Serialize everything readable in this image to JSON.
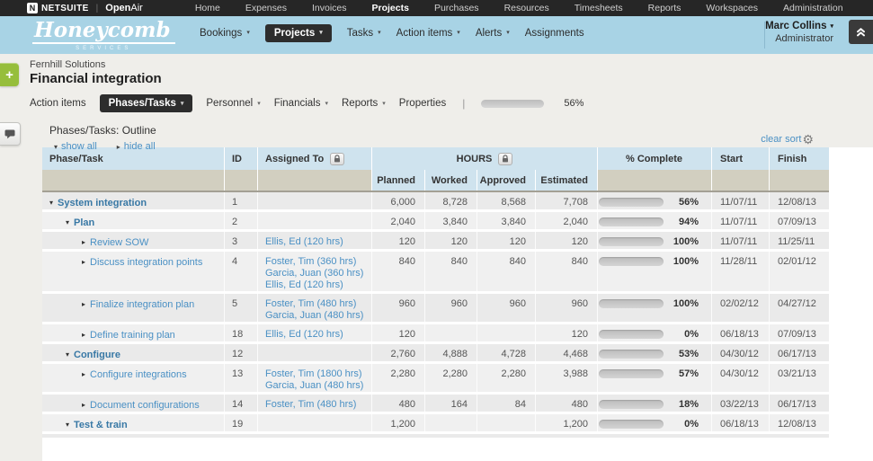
{
  "colors": {
    "accent_blue": "#4fb1e1",
    "header_blue": "#cfe3ee",
    "tan": "#d2cfc0",
    "nav_blue": "#a8d3e5",
    "add_green": "#96be3c"
  },
  "topnav": {
    "netsuite_icon": "N",
    "netsuite": "NETSUITE",
    "openair_bold": "Open",
    "openair_light": "Air",
    "items": [
      {
        "label": "Home"
      },
      {
        "label": "Expenses"
      },
      {
        "label": "Invoices"
      },
      {
        "label": "Projects",
        "active": true
      },
      {
        "label": "Purchases"
      },
      {
        "label": "Resources"
      },
      {
        "label": "Timesheets"
      },
      {
        "label": "Reports"
      },
      {
        "label": "Workspaces"
      },
      {
        "label": "Administration"
      }
    ]
  },
  "subnav": {
    "logo_name": "Honeycomb",
    "logo_sub": "SERVICES",
    "items": [
      {
        "label": "Bookings",
        "dropdown": true
      },
      {
        "label": "Projects",
        "dropdown": true,
        "active": true
      },
      {
        "label": "Tasks",
        "dropdown": true
      },
      {
        "label": "Action items",
        "dropdown": true
      },
      {
        "label": "Alerts",
        "dropdown": true
      },
      {
        "label": "Assignments"
      }
    ],
    "user": {
      "name": "Marc Collins",
      "role": "Administrator"
    }
  },
  "header": {
    "client": "Fernhill Solutions",
    "project": "Financial integration",
    "add_label": "+"
  },
  "tabs": {
    "items": [
      {
        "label": "Action items"
      },
      {
        "label": "Phases/Tasks",
        "dropdown": true,
        "active": true
      },
      {
        "label": "Personnel",
        "dropdown": true
      },
      {
        "label": "Financials",
        "dropdown": true
      },
      {
        "label": "Reports",
        "dropdown": true
      },
      {
        "label": "Properties"
      }
    ],
    "progress_percent": 56,
    "progress_label": "56%"
  },
  "section": {
    "title": "Phases/Tasks: Outline",
    "show_all": "show all",
    "hide_all": "hide all",
    "clear_sort": "clear sort"
  },
  "table": {
    "headers": {
      "phase_task": "Phase/Task",
      "id": "ID",
      "assigned_to": "Assigned To",
      "hours": "HOURS",
      "planned": "Planned",
      "worked": "Worked",
      "approved": "Approved",
      "estimated": "Estimated",
      "pct_complete": "% Complete",
      "start": "Start",
      "finish": "Finish"
    },
    "rows": [
      {
        "level": 1,
        "type": "phase",
        "arrow": "expanded",
        "name": "System integration",
        "id": "1",
        "assigned": [],
        "planned": "6,000",
        "worked": "8,728",
        "approved": "8,568",
        "estimated": "7,708",
        "percent": 56,
        "percent_label": "56%",
        "start": "11/07/11",
        "finish": "12/08/13"
      },
      {
        "level": 2,
        "type": "phase",
        "arrow": "expanded",
        "name": "Plan",
        "id": "2",
        "assigned": [],
        "planned": "2,040",
        "worked": "3,840",
        "approved": "3,840",
        "estimated": "2,040",
        "percent": 94,
        "percent_label": "94%",
        "start": "11/07/11",
        "finish": "07/09/13"
      },
      {
        "level": 3,
        "type": "task",
        "arrow": "collapsed",
        "name": "Review SOW",
        "id": "3",
        "assigned": [
          "Ellis, Ed (120 hrs)"
        ],
        "planned": "120",
        "worked": "120",
        "approved": "120",
        "estimated": "120",
        "percent": 100,
        "percent_label": "100%",
        "start": "11/07/11",
        "finish": "11/25/11"
      },
      {
        "level": 3,
        "type": "task",
        "arrow": "collapsed",
        "name": "Discuss integration points",
        "id": "4",
        "assigned": [
          "Foster, Tim (360 hrs)",
          "Garcia, Juan (360 hrs)",
          "Ellis, Ed (120 hrs)"
        ],
        "planned": "840",
        "worked": "840",
        "approved": "840",
        "estimated": "840",
        "percent": 100,
        "percent_label": "100%",
        "start": "11/28/11",
        "finish": "02/01/12"
      },
      {
        "level": 3,
        "type": "task",
        "arrow": "collapsed",
        "name": "Finalize integration plan",
        "id": "5",
        "assigned": [
          "Foster, Tim (480 hrs)",
          "Garcia, Juan (480 hrs)"
        ],
        "planned": "960",
        "worked": "960",
        "approved": "960",
        "estimated": "960",
        "percent": 100,
        "percent_label": "100%",
        "start": "02/02/12",
        "finish": "04/27/12"
      },
      {
        "level": 3,
        "type": "task",
        "arrow": "collapsed",
        "name": "Define training plan",
        "id": "18",
        "assigned": [
          "Ellis, Ed (120 hrs)"
        ],
        "planned": "120",
        "worked": "",
        "approved": "",
        "estimated": "120",
        "percent": 0,
        "percent_label": "0%",
        "start": "06/18/13",
        "finish": "07/09/13"
      },
      {
        "level": 2,
        "type": "phase",
        "arrow": "expanded",
        "name": "Configure",
        "id": "12",
        "assigned": [],
        "planned": "2,760",
        "worked": "4,888",
        "approved": "4,728",
        "estimated": "4,468",
        "percent": 53,
        "percent_label": "53%",
        "start": "04/30/12",
        "finish": "06/17/13"
      },
      {
        "level": 3,
        "type": "task",
        "arrow": "collapsed",
        "name": "Configure integrations",
        "id": "13",
        "assigned": [
          "Foster, Tim (1800 hrs)",
          "Garcia, Juan (480 hrs)"
        ],
        "planned": "2,280",
        "worked": "2,280",
        "approved": "2,280",
        "estimated": "3,988",
        "percent": 57,
        "percent_label": "57%",
        "start": "04/30/12",
        "finish": "03/21/13"
      },
      {
        "level": 3,
        "type": "task",
        "arrow": "collapsed",
        "name": "Document configurations",
        "id": "14",
        "assigned": [
          "Foster, Tim (480 hrs)"
        ],
        "planned": "480",
        "worked": "164",
        "approved": "84",
        "estimated": "480",
        "percent": 18,
        "percent_label": "18%",
        "start": "03/22/13",
        "finish": "06/17/13"
      },
      {
        "level": 2,
        "type": "phase",
        "arrow": "expanded",
        "name": "Test & train",
        "id": "19",
        "assigned": [],
        "planned": "1,200",
        "worked": "",
        "approved": "",
        "estimated": "1,200",
        "percent": 0,
        "percent_label": "0%",
        "start": "06/18/13",
        "finish": "12/08/13"
      }
    ]
  }
}
